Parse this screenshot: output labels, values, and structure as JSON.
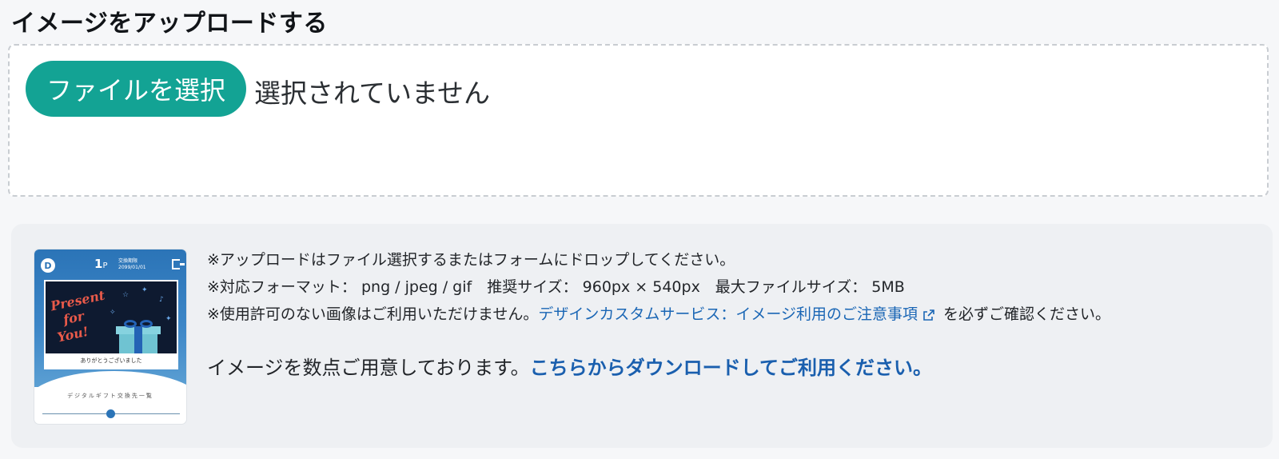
{
  "header": {
    "title": "イメージをアップロードする"
  },
  "upload": {
    "button_label": "ファイルを選択",
    "status_text": "選択されていません"
  },
  "sample_image": {
    "points": "1",
    "points_unit": "P",
    "date_label": "交換期限",
    "date_value": "2099/01/01",
    "card_text_line1": "Present",
    "card_text_line2": "for",
    "card_text_line3": "You!",
    "card_caption": "ありがとうございました",
    "footer_text": "デジタルギフト交換先一覧",
    "logo_letter": "D",
    "icons": [
      "logo-icon",
      "exit-icon",
      "gift-icon"
    ]
  },
  "notes": {
    "line1": "※アップロードはファイル選択するまたはフォームにドロップしてください。",
    "line2": "※対応フォーマット： png / jpeg / gif　推奨サイズ： 960px × 540px　最大ファイルサイズ： 5MB",
    "line3_prefix": "※使用許可のない画像はご利用いただけません。",
    "line3_link": "デザインカスタムサービス：イメージ利用のご注意事項",
    "line3_suffix": "を必ずご確認ください。"
  },
  "download": {
    "prefix": "イメージを数点ご用意しております。",
    "link_text": "こちらからダウンロードしてご利用ください。"
  },
  "colors": {
    "accent": "#13a394",
    "link": "#1a66b5",
    "panel_bg": "#eef0f3"
  }
}
